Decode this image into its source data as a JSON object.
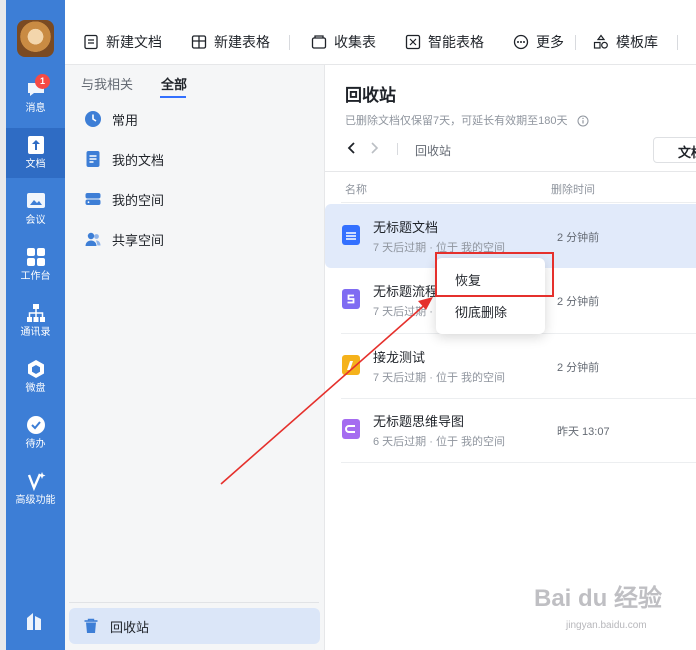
{
  "rail": {
    "items": [
      {
        "label": "消息",
        "badge": "1"
      },
      {
        "label": "文档"
      },
      {
        "label": "会议"
      },
      {
        "label": "工作台"
      },
      {
        "label": "通讯录"
      },
      {
        "label": "微盘"
      },
      {
        "label": "待办"
      },
      {
        "label": "高级功能"
      }
    ]
  },
  "toolbar": {
    "new_doc": "新建文档",
    "new_sheet": "新建表格",
    "collect_form": "收集表",
    "smart_sheet": "智能表格",
    "more": "更多",
    "templates": "模板库"
  },
  "left": {
    "tabs": [
      "与我相关",
      "全部"
    ],
    "nav": [
      "常用",
      "我的文档",
      "我的空间",
      "共享空间"
    ],
    "trash": "回收站"
  },
  "main": {
    "title": "回收站",
    "subtitle": "已删除文档仅保留7天，可延长有效期至180天",
    "breadcrumb": "回收站",
    "view_button": "文档",
    "col_name": "名称",
    "col_time": "删除时间",
    "files": [
      {
        "name": "无标题文档",
        "meta": "7 天后过期 · 位于 我的空间",
        "time": "2 分钟前"
      },
      {
        "name": "无标题流程图",
        "meta": "7 天后过期 · 位于 我的空间",
        "time": "2 分钟前"
      },
      {
        "name": "接龙测试",
        "meta": "7 天后过期 · 位于 我的空间",
        "time": "2 分钟前"
      },
      {
        "name": "无标题思维导图",
        "meta": "6 天后过期 · 位于 我的空间",
        "time": "昨天 13:07"
      }
    ]
  },
  "context_menu": {
    "restore": "恢复",
    "delete_forever": "彻底删除"
  },
  "watermark": {
    "brand": "Bai du 经验",
    "url": "jingyan.baidu.com"
  },
  "colors": {
    "rail": "#3d7ed6",
    "accent": "#3370ff",
    "doc_icon": "#3370ff",
    "flow_icon": "#7f6cf2",
    "jielong_icon": "#f5b21b",
    "mindmap_icon": "#a56cf0",
    "annotation": "#e5302c"
  }
}
